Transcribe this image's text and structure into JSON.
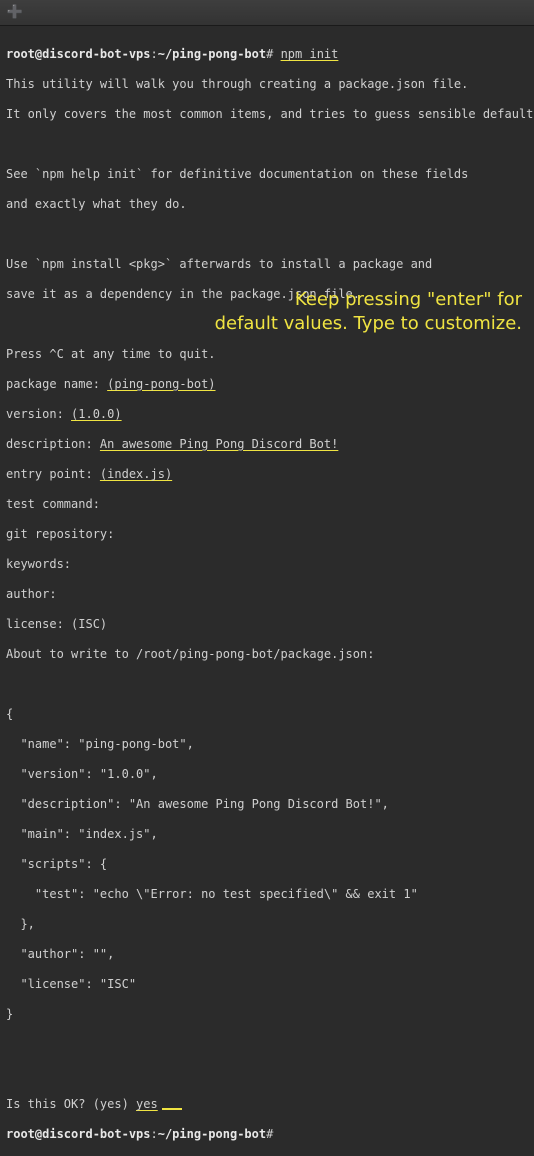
{
  "titlebar": {
    "newtab_icon": "➕"
  },
  "prompt": {
    "user_host": "root@discord-bot-vps",
    "sep": ":",
    "path": "~/ping-pong-bot",
    "hash": "#"
  },
  "cmd": {
    "text": "npm init"
  },
  "intro": {
    "l1": "This utility will walk you through creating a package.json file.",
    "l2": "It only covers the most common items, and tries to guess sensible defaults.",
    "l3": "See `npm help init` for definitive documentation on these fields",
    "l4": "and exactly what they do.",
    "l5": "Use `npm install <pkg>` afterwards to install a package and",
    "l6": "save it as a dependency in the package.json file.",
    "l7": "Press ^C at any time to quit."
  },
  "fields": {
    "pkg_label": "package name: ",
    "pkg_val": "(ping-pong-bot)",
    "ver_label": "version: ",
    "ver_val": "(1.0.0)",
    "desc_label": "description: ",
    "desc_val": "An awesome Ping Pong Discord Bot!",
    "entry_label": "entry point: ",
    "entry_val": "(index.js)",
    "test_label": "test command:",
    "git_label": "git repository:",
    "keywords_label": "keywords:",
    "author_label": "author:",
    "license_label": "license: (ISC)"
  },
  "about": {
    "text": "About to write to /root/ping-pong-bot/package.json:"
  },
  "json_preview": {
    "open": "{",
    "l1": "  \"name\": \"ping-pong-bot\",",
    "l2": "  \"version\": \"1.0.0\",",
    "l3": "  \"description\": \"An awesome Ping Pong Discord Bot!\",",
    "l4": "  \"main\": \"index.js\",",
    "l5": "  \"scripts\": {",
    "l6": "    \"test\": \"echo \\\"Error: no test specified\\\" && exit 1\"",
    "l7": "  },",
    "l8": "  \"author\": \"\",",
    "l9": "  \"license\": \"ISC\"",
    "close": "}"
  },
  "confirm": {
    "q": "Is this OK? (yes) ",
    "a": "yes"
  },
  "annotation": {
    "l1": "Keep pressing \"enter\" for",
    "l2": "default values. Type to customize."
  }
}
